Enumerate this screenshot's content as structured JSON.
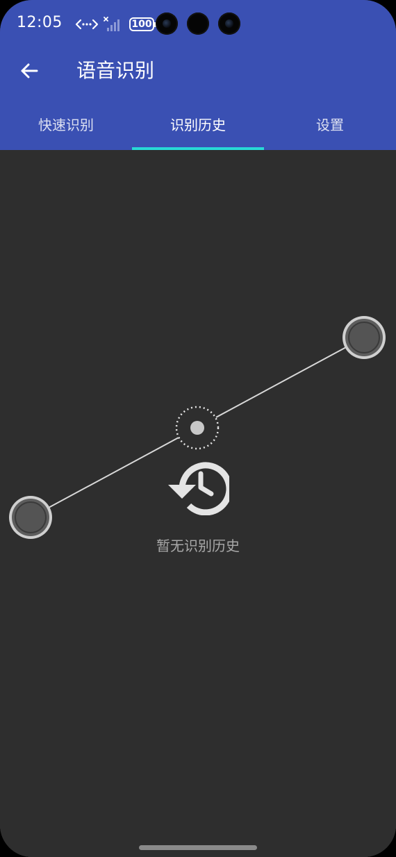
{
  "status_bar": {
    "time": "12:05",
    "battery": "100",
    "icons": [
      "network-transfer-icon",
      "signal-icon",
      "battery-icon"
    ]
  },
  "app_bar": {
    "title": "语音识别",
    "back_icon": "arrow-back-icon"
  },
  "tabs": [
    {
      "label": "快速识别",
      "active": false
    },
    {
      "label": "识别历史",
      "active": true
    },
    {
      "label": "设置",
      "active": false
    }
  ],
  "empty_state": {
    "icon": "history-icon",
    "message": "暂无识别历史"
  },
  "colors": {
    "primary": "#3a50b3",
    "tab_indicator": "#28d9d6",
    "background": "#2e2e2e",
    "empty_text": "#a8a8a8"
  }
}
